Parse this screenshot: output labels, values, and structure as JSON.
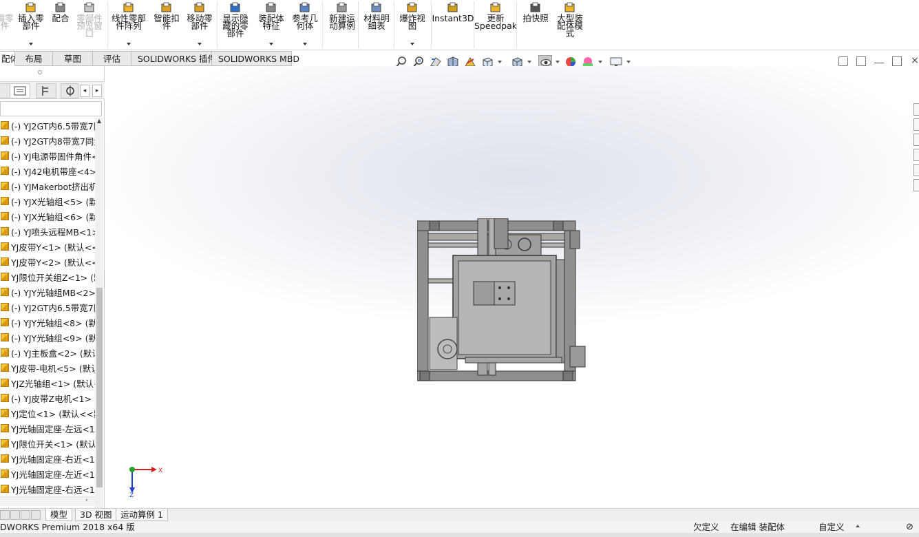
{
  "ribbon": {
    "buttons": [
      {
        "label": "插入零\n部件",
        "dropdown": true,
        "disabled": false
      },
      {
        "label": "配合",
        "dropdown": false,
        "disabled": false
      },
      {
        "label": "零部件\n预览窗\n口",
        "dropdown": false,
        "disabled": true
      },
      {
        "label": "线性零部\n件阵列",
        "dropdown": true,
        "disabled": false
      },
      {
        "label": "智能扣\n件",
        "dropdown": false,
        "disabled": false
      },
      {
        "label": "移动零\n部件",
        "dropdown": true,
        "disabled": false
      },
      {
        "label": "显示隐\n藏的零\n部件",
        "dropdown": false,
        "disabled": false
      },
      {
        "label": "装配体\n特征",
        "dropdown": true,
        "disabled": false
      },
      {
        "label": "参考几\n何体",
        "dropdown": true,
        "disabled": false
      },
      {
        "label": "新建运\n动算例",
        "dropdown": false,
        "disabled": false
      },
      {
        "label": "材料明\n细表",
        "dropdown": false,
        "disabled": false
      },
      {
        "label": "爆炸视\n图",
        "dropdown": true,
        "disabled": false
      },
      {
        "label": "Instant3D",
        "dropdown": false,
        "disabled": false
      },
      {
        "label": "更新\nSpeedpak",
        "dropdown": false,
        "disabled": false
      },
      {
        "label": "拍快照",
        "dropdown": false,
        "disabled": false
      },
      {
        "label": "大型装\n配体模\n式",
        "dropdown": false,
        "disabled": false
      }
    ],
    "clipped_left_label": "辑零\n件"
  },
  "command_tabs": [
    "配体",
    "布局",
    "草图",
    "评估",
    "SOLIDWORKS 插件",
    "SOLIDWORKS MBD"
  ],
  "tree": {
    "items": [
      "(-) YJ2GT内6.5带宽7同",
      "(-) YJ2GT内8带宽7同步",
      "(-) YJ电源带固件角件<",
      "(-) YJ42电机带座<4>",
      "(-) YJMakerbot挤出机",
      "(-) YJX光轴组<5> (默",
      "(-) YJX光轴组<6> (默",
      "(-) YJ喷头远程MB<1>",
      "YJ皮带Y<1> (默认<<",
      "YJ皮带Y<2> (默认<<",
      "YJ限位开关组Z<1> (默",
      "(-) YJY光轴组MB<2>",
      "(-) YJ2GT内6.5带宽7同",
      "(-) YJY光轴组<8> (默",
      "(-) YJY光轴组<9> (默",
      "(-) YJ主板盒<2> (默认",
      "YJ皮带-电机<5> (默认",
      "YJZ光轴组<1> (默认<",
      "(-) YJ皮带Z电机<1> (",
      "YJ定位<1> (默认<<默",
      "YJ光轴固定座-左远<1",
      "YJ限位开关<1> (默认",
      "YJ光轴固定座-右近<1",
      "YJ光轴固定座-左近<1",
      "YJ光轴固定座-右远<1"
    ]
  },
  "triad": {
    "x_label": "X",
    "z_label": "Z"
  },
  "bottom_tabs": [
    "模型",
    "3D 视图",
    "运动算例 1"
  ],
  "status": {
    "app": "DWORKS Premium 2018 x64 版",
    "underdefined": "欠定义",
    "editing": "在编辑 装配体",
    "units": "自定义"
  },
  "colors": {
    "accent": "#1f5fbf",
    "model_gray": "#9a9a9a"
  }
}
